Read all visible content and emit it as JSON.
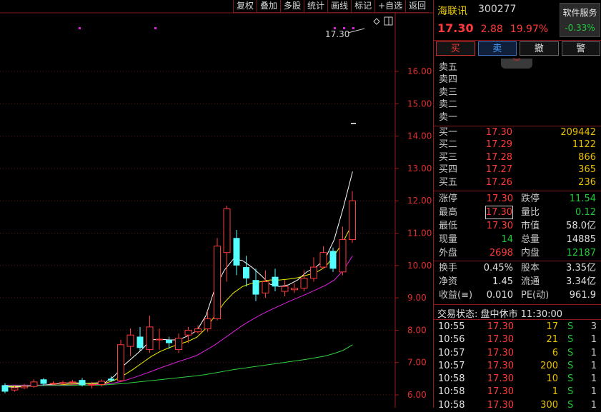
{
  "toolbar": [
    "复权",
    "叠加",
    "多股",
    "统计",
    "画线",
    "标记",
    "+自选",
    "返回"
  ],
  "chart_data": {
    "type": "candlestick",
    "y_ticks": [
      "16.00",
      "15.00",
      "14.00",
      "13.00",
      "12.00",
      "11.00",
      "10.00",
      "9.00",
      "8.00",
      "7.00",
      "6.00"
    ],
    "ylim": [
      5.85,
      16.6
    ],
    "last_price_label": "17.30",
    "candles": [
      [
        6.3,
        6.1,
        6.36,
        6.05
      ],
      [
        6.15,
        6.22,
        6.3,
        6.1
      ],
      [
        6.22,
        6.26,
        6.34,
        6.18
      ],
      [
        6.26,
        6.4,
        6.48,
        6.22
      ],
      [
        6.48,
        6.34,
        6.52,
        6.28
      ],
      [
        6.34,
        6.36,
        6.42,
        6.3
      ],
      [
        6.36,
        6.38,
        6.44,
        6.32
      ],
      [
        6.38,
        6.4,
        6.46,
        6.34
      ],
      [
        6.46,
        6.3,
        6.52,
        6.26
      ],
      [
        6.3,
        6.32,
        6.4,
        6.2
      ],
      [
        6.32,
        6.42,
        6.48,
        6.26
      ],
      [
        6.5,
        6.44,
        6.58,
        6.4
      ],
      [
        6.44,
        7.55,
        7.7,
        6.42
      ],
      [
        7.5,
        7.85,
        8.05,
        7.2
      ],
      [
        7.8,
        7.45,
        8.1,
        7.35
      ],
      [
        7.4,
        8.1,
        8.45,
        7.3
      ],
      [
        7.7,
        7.72,
        8.05,
        7.4
      ],
      [
        7.7,
        7.6,
        7.8,
        7.42
      ],
      [
        7.4,
        7.75,
        7.9,
        7.3
      ],
      [
        7.85,
        8.0,
        8.1,
        7.6
      ],
      [
        7.95,
        8.04,
        8.15,
        7.9
      ],
      [
        8.04,
        8.35,
        8.6,
        7.95
      ],
      [
        8.35,
        10.6,
        10.85,
        8.3
      ],
      [
        10.4,
        11.75,
        11.85,
        9.5
      ],
      [
        10.85,
        10.0,
        11.1,
        9.7
      ],
      [
        9.95,
        9.6,
        10.3,
        9.35
      ],
      [
        9.55,
        9.1,
        9.9,
        8.9
      ],
      [
        9.15,
        9.5,
        9.85,
        9.0
      ],
      [
        9.65,
        9.35,
        9.9,
        9.2
      ],
      [
        9.2,
        9.35,
        9.55,
        9.05
      ],
      [
        9.25,
        9.3,
        9.45,
        9.15
      ],
      [
        9.3,
        9.6,
        9.85,
        9.2
      ],
      [
        9.6,
        9.95,
        10.25,
        9.5
      ],
      [
        9.95,
        10.4,
        10.6,
        9.9
      ],
      [
        10.45,
        9.9,
        10.55,
        9.8
      ],
      [
        9.8,
        10.8,
        11.2,
        9.7
      ],
      [
        10.8,
        12.0,
        12.3,
        10.7
      ]
    ],
    "ma_series": [
      {
        "color": "#ffffff",
        "values": [
          6.25,
          6.24,
          6.25,
          6.28,
          6.3,
          6.32,
          6.35,
          6.37,
          6.37,
          6.36,
          6.37,
          6.38,
          6.58,
          6.9,
          7.15,
          7.4,
          7.7,
          7.72,
          7.7,
          7.7,
          7.82,
          7.98,
          8.45,
          9.3,
          9.85,
          10.2,
          10.15,
          9.95,
          9.7,
          9.42,
          9.35,
          9.4,
          9.55,
          9.8,
          9.95,
          10.2,
          10.8,
          11.8,
          12.9
        ]
      },
      {
        "color": "#f0f000",
        "values": [
          6.26,
          6.26,
          6.27,
          6.28,
          6.29,
          6.3,
          6.31,
          6.33,
          6.34,
          6.35,
          6.35,
          6.36,
          6.45,
          6.6,
          6.78,
          6.98,
          7.18,
          7.34,
          7.46,
          7.56,
          7.65,
          7.78,
          8.05,
          8.45,
          8.85,
          9.15,
          9.35,
          9.45,
          9.5,
          9.55,
          9.55,
          9.58,
          9.62,
          9.7,
          9.78,
          9.95,
          10.3,
          10.75,
          11.3
        ]
      },
      {
        "color": "#e020e0",
        "values": [
          6.3,
          6.3,
          6.3,
          6.3,
          6.3,
          6.3,
          6.3,
          6.3,
          6.31,
          6.31,
          6.32,
          6.33,
          6.37,
          6.43,
          6.52,
          6.62,
          6.72,
          6.83,
          6.93,
          7.03,
          7.12,
          7.22,
          7.38,
          7.55,
          7.75,
          7.95,
          8.15,
          8.32,
          8.48,
          8.62,
          8.75,
          8.88,
          9.0,
          9.12,
          9.25,
          9.38,
          9.55,
          9.85,
          10.3
        ]
      },
      {
        "color": "#30d040",
        "values": [
          6.28,
          6.28,
          6.28,
          6.28,
          6.29,
          6.29,
          6.29,
          6.29,
          6.3,
          6.3,
          6.3,
          6.31,
          6.33,
          6.35,
          6.38,
          6.41,
          6.44,
          6.47,
          6.5,
          6.53,
          6.56,
          6.59,
          6.63,
          6.68,
          6.73,
          6.78,
          6.82,
          6.86,
          6.9,
          6.94,
          6.98,
          7.02,
          7.06,
          7.1,
          7.15,
          7.2,
          7.28,
          7.38,
          7.55
        ]
      }
    ]
  },
  "header": {
    "stock_name": "海联讯",
    "stock_code": "300277",
    "sector_name": "软件服务",
    "sector_change": "-0.33%",
    "price": "17.30",
    "change": "2.88",
    "change_pct": "19.97%"
  },
  "actions": {
    "buy": "买",
    "sell": "卖",
    "cancel": "撤",
    "alert": "警"
  },
  "colors": {
    "up": "#ff3a3a",
    "down": "#22c83c",
    "volume": "#e8c000",
    "grid": "#8a1a1a"
  },
  "asks": [
    {
      "label": "卖五",
      "price": "",
      "vol": ""
    },
    {
      "label": "卖四",
      "price": "",
      "vol": ""
    },
    {
      "label": "卖三",
      "price": "",
      "vol": ""
    },
    {
      "label": "卖二",
      "price": "",
      "vol": ""
    },
    {
      "label": "卖一",
      "price": "",
      "vol": ""
    }
  ],
  "bids": [
    {
      "label": "买一",
      "price": "17.30",
      "vol": "209442"
    },
    {
      "label": "买二",
      "price": "17.29",
      "vol": "1122"
    },
    {
      "label": "买三",
      "price": "17.28",
      "vol": "866"
    },
    {
      "label": "买四",
      "price": "17.27",
      "vol": "365"
    },
    {
      "label": "买五",
      "price": "17.26",
      "vol": "236"
    }
  ],
  "stats1": [
    {
      "l1": "涨停",
      "v1": "17.30",
      "l2": "跌停",
      "v2": "11.54"
    },
    {
      "l1": "最高",
      "v1": "17.30",
      "l2": "量比",
      "v2": "0.12"
    },
    {
      "l1": "最低",
      "v1": "17.30",
      "l2": "市值",
      "v2": "58.0亿"
    },
    {
      "l1": "现量",
      "v1": "14",
      "l2": "总量",
      "v2": "14885"
    },
    {
      "l1": "外盘",
      "v1": "2698",
      "l2": "内盘",
      "v2": "12187"
    }
  ],
  "stats2": [
    {
      "l1": "换手",
      "v1": "0.45%",
      "l2": "股本",
      "v2": "3.35亿"
    },
    {
      "l1": "净资",
      "v1": "1.45",
      "l2": "流通",
      "v2": "3.34亿"
    },
    {
      "l1": "收益(≡)",
      "v1": "0.010",
      "l2": "PE(动)",
      "v2": "961.9"
    }
  ],
  "trade_status": "交易状态: 盘中休市 11:30:00",
  "ticks": [
    {
      "time": "10:55",
      "price": "17.30",
      "vol": "17",
      "side": "S",
      "n": "3"
    },
    {
      "time": "10:56",
      "price": "17.30",
      "vol": "21",
      "side": "S",
      "n": "1"
    },
    {
      "time": "10:57",
      "price": "17.30",
      "vol": "6",
      "side": "S",
      "n": "1"
    },
    {
      "time": "10:57",
      "price": "17.30",
      "vol": "200",
      "side": "S",
      "n": "1"
    },
    {
      "time": "10:58",
      "price": "17.30",
      "vol": "10",
      "side": "S",
      "n": "1"
    },
    {
      "time": "10:58",
      "price": "17.30",
      "vol": "1",
      "side": "S",
      "n": "1"
    },
    {
      "time": "10:58",
      "price": "17.30",
      "vol": "300",
      "side": "S",
      "n": "1"
    }
  ]
}
